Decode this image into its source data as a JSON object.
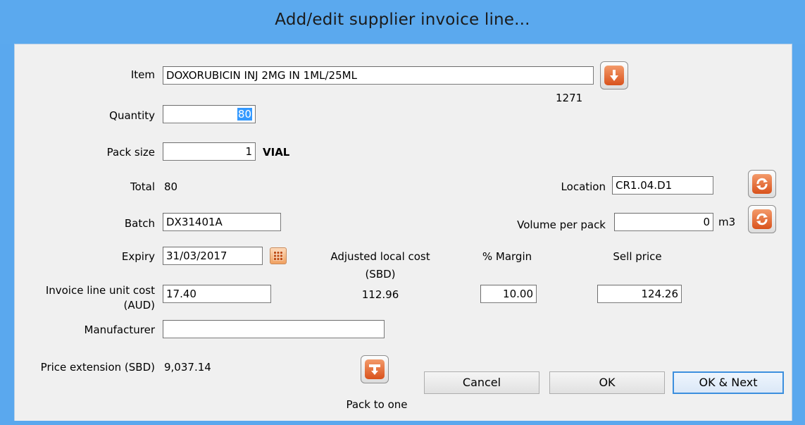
{
  "window": {
    "title": "Add/edit supplier invoice line..."
  },
  "item": {
    "label": "Item",
    "value": "DOXORUBICIN INJ 2MG IN 1ML/25ML",
    "code": "1271",
    "lookup_icon": "arrow-down-icon"
  },
  "quantity": {
    "label": "Quantity",
    "value": "80"
  },
  "pack_size": {
    "label": "Pack size",
    "value": "1",
    "unit": "VIAL"
  },
  "total": {
    "label": "Total",
    "value": "80"
  },
  "location": {
    "label": "Location",
    "value": "CR1.04.D1",
    "icon": "refresh-icon"
  },
  "batch": {
    "label": "Batch",
    "value": "DX31401A"
  },
  "volume": {
    "label": "Volume per pack",
    "value": "0",
    "unit": "m3",
    "icon": "refresh-icon"
  },
  "expiry": {
    "label": "Expiry",
    "value": "31/03/2017",
    "icon": "calendar-icon"
  },
  "adjusted_cost": {
    "label_line1": "Adjusted local cost",
    "label_line2": "(SBD)",
    "value": "112.96"
  },
  "margin": {
    "label": "% Margin",
    "value": "10.00"
  },
  "sell_price": {
    "label": "Sell price",
    "value": "124.26"
  },
  "unit_cost": {
    "label_line1": "Invoice line unit cost",
    "label_line2": "(AUD)",
    "value": "17.40"
  },
  "manufacturer": {
    "label": "Manufacturer",
    "value": ""
  },
  "price_extension": {
    "label": "Price extension (SBD)",
    "value": "9,037.14"
  },
  "pack_to_one": {
    "label": "Pack to one",
    "icon": "pack-to-one-icon"
  },
  "buttons": {
    "cancel": "Cancel",
    "ok": "OK",
    "ok_next": "OK & Next"
  },
  "colors": {
    "titlebar": "#5ba9ee",
    "accent_orange": "#d9521c",
    "default_button_border": "#3c8fde"
  }
}
